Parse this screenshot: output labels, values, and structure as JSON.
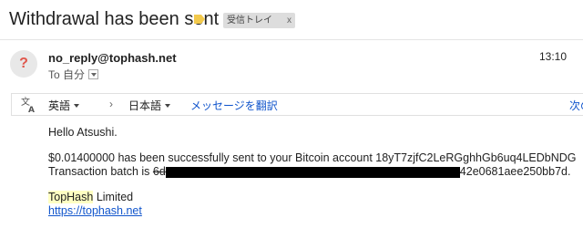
{
  "subject": {
    "title": "Withdrawal has been sent",
    "label_color": "#f2c94c",
    "inbox_chip": "受信トレイ",
    "inbox_chip_close": "x"
  },
  "header": {
    "avatar_glyph": "?",
    "sender": "no_reply@tophash.net",
    "to_prefix": "To",
    "to_value": "自分",
    "time": "13:10"
  },
  "translate": {
    "icon": "translate-icon",
    "source_lang": "英語",
    "arrow": "›",
    "target_lang": "日本語",
    "action": "メッセージを翻訳",
    "next": "次の"
  },
  "message": {
    "greeting": "Hello Atsushi.",
    "sent_line": "$0.01400000 has been successfully sent to your Bitcoin account 18yT7zjfC2LeRGghhGb6uq4LEDbNDG",
    "batch_label": "Transaction batch is",
    "batch_start": "6d",
    "batch_end": "42e0681aee250bb7d.",
    "company_highlight": "TopHash",
    "company_rest": " Limited",
    "site_link": "https://tophash.net"
  }
}
